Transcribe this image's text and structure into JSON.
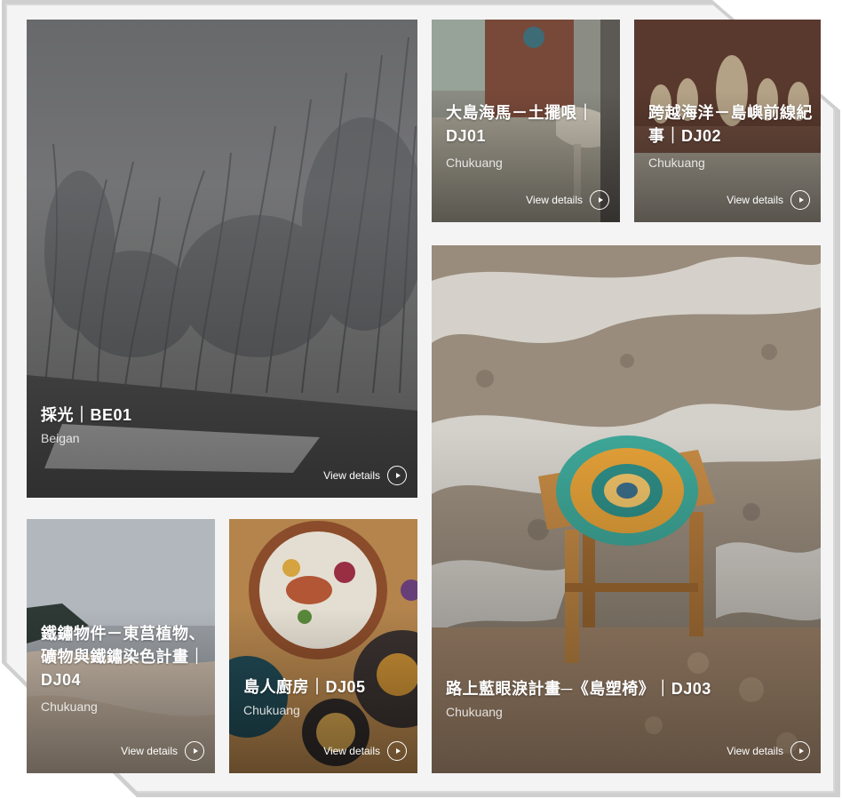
{
  "cards": [
    {
      "id": "be01",
      "title": "採光｜BE01",
      "location": "Beigan",
      "action": "View details"
    },
    {
      "id": "dj01",
      "title": "大島海馬－土擺哏｜DJ01",
      "location": "Chukuang",
      "action": "View details"
    },
    {
      "id": "dj02",
      "title": "跨越海洋－島嶼前線紀事｜DJ02",
      "location": "Chukuang",
      "action": "View details"
    },
    {
      "id": "dj03",
      "title": "路上藍眼淚計畫─《島塑椅》｜DJ03",
      "location": "Chukuang",
      "action": "View details"
    },
    {
      "id": "dj04",
      "title": "鐵鏽物件－東莒植物、礦物與鐵鏽染色計畫｜DJ04",
      "location": "Chukuang",
      "action": "View details"
    },
    {
      "id": "dj05",
      "title": "島人廚房｜DJ05",
      "location": "Chukuang",
      "action": "View details"
    }
  ],
  "icons": {
    "view_details": "play-circle-icon"
  },
  "colors": {
    "text": "#ffffff",
    "frame": "#f4f4f4",
    "frame_border": "#cfcfcf"
  }
}
